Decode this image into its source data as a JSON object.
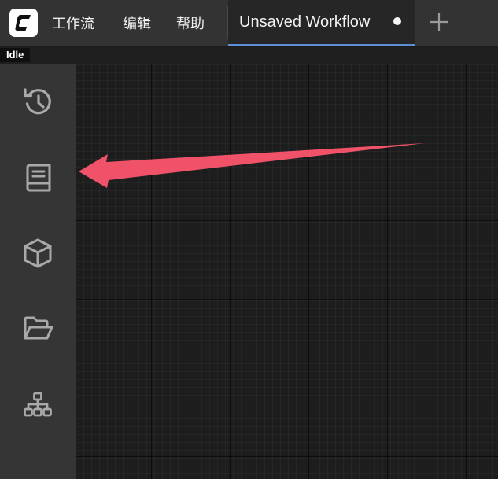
{
  "menu": {
    "workflow": "工作流",
    "edit": "编辑",
    "help": "帮助"
  },
  "tab": {
    "title": "Unsaved Workflow",
    "modified": true
  },
  "status": {
    "label": "Idle"
  },
  "sidebar": {
    "items": [
      {
        "icon": "history-icon"
      },
      {
        "icon": "book-icon"
      },
      {
        "icon": "cube-icon"
      },
      {
        "icon": "folder-open-icon"
      },
      {
        "icon": "sitemap-icon"
      }
    ]
  },
  "colors": {
    "topbar": "#333333",
    "tab_active": "#262626",
    "tab_indicator": "#5b8fd6",
    "sidebar": "#353535",
    "canvas": "#1d1d1d",
    "icon": "#aaaaaa",
    "annotation_arrow": "#f0526a"
  }
}
